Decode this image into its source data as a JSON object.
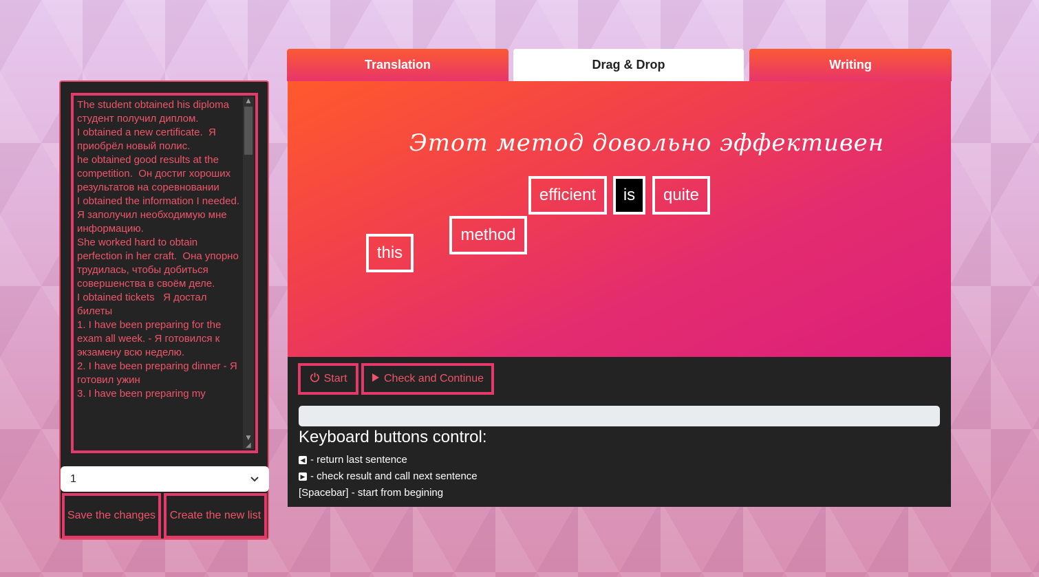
{
  "notes": {
    "text": "The student obtained his diploma  студент получил диплом.\nI obtained a new certificate.  Я приобрёл новый полис.\nhe obtained good results at the competition.  Он достиг хороших результатов на соревновании\nI obtained the information I needed.  Я заполучил необходимую мне информацию.\nShe worked hard to obtain perfection in her craft.  Она упорно трудилась, чтобы добиться совершенства в своём деле.\nI obtained tickets   Я достал билеты\n1. I have been preparing for the exam all week. - Я готовился к экзамену всю неделю.\n2. I have been preparing dinner - Я готовил ужин\n3. I have been preparing my"
  },
  "list_select": {
    "value": "1"
  },
  "left_buttons": {
    "save": "Save the changes",
    "create": "Create the new list"
  },
  "tabs": [
    {
      "label": "Translation",
      "active": false
    },
    {
      "label": "Drag & Drop",
      "active": true
    },
    {
      "label": "Writing",
      "active": false
    }
  ],
  "game": {
    "sentence": "Этот метод довольно эффективен",
    "words": [
      "efficient",
      "is",
      "quite",
      "method",
      "this"
    ]
  },
  "controls": {
    "start": "Start",
    "check": "Check and Continue"
  },
  "progress": {
    "fraction": 0
  },
  "keyboard": {
    "title": "Keyboard buttons control:",
    "back": "- return last sentence",
    "next": "- check result and call next sentence",
    "space": "[Spacebar] - start from begining"
  },
  "colors": {
    "accent": "#e43a6b",
    "panel": "#232323",
    "gradient_start": "#ff5a2c",
    "gradient_end": "#dc1f7a"
  },
  "icons": {
    "start": "power-icon",
    "check": "play-icon",
    "back": "caret-left-square-icon",
    "next": "caret-right-square-icon"
  }
}
